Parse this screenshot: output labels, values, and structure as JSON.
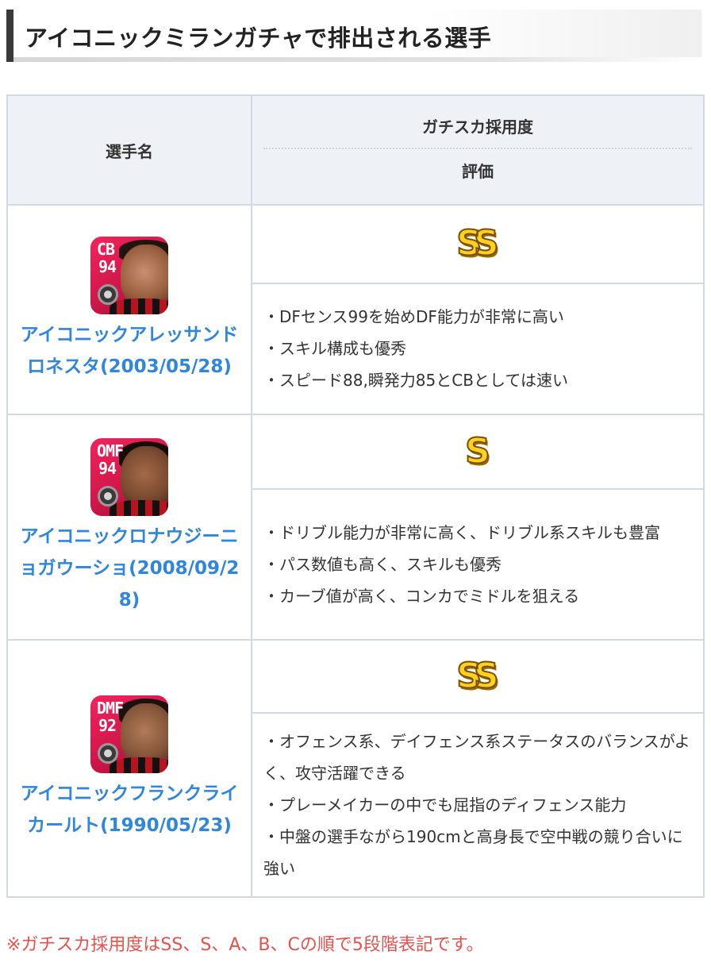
{
  "heading": "アイコニックミランガチャで排出される選手",
  "table": {
    "header_left": "選手名",
    "header_right_top": "ガチスカ採用度",
    "header_right_bottom": "評価"
  },
  "players": [
    {
      "position": "CB",
      "rating": "94",
      "name": "アイコニックアレッサンドロネスタ(2003/05/28)",
      "rank": "SS",
      "points": [
        "・DFセンス99を始めDF能力が非常に高い",
        "・スキル構成も優秀",
        "・スピード88,瞬発力85とCBとしては速い"
      ]
    },
    {
      "position": "OMF",
      "rating": "94",
      "name": "アイコニックロナウジーニョガウーショ(2008/09/28)",
      "rank": "S",
      "points": [
        "・ドリブル能力が非常に高く、ドリブル系スキルも豊富",
        "・パス数値も高く、スキルも優秀",
        "・カーブ値が高く、コンカでミドルを狙える"
      ]
    },
    {
      "position": "DMF",
      "rating": "92",
      "name": "アイコニックフランクライカールト(1990/05/23)",
      "rank": "SS",
      "points": [
        "・オフェンス系、デイフェンス系ステータスのバランスがよく、攻守活躍できる",
        "・プレーメイカーの中でも屈指のディフェンス能力",
        "・中盤の選手ながら190cmと高身長で空中戦の競り合いに強い"
      ]
    }
  ],
  "note": "※ガチスカ採用度はSS、S、A、B、Cの順で5段階表記です。"
}
